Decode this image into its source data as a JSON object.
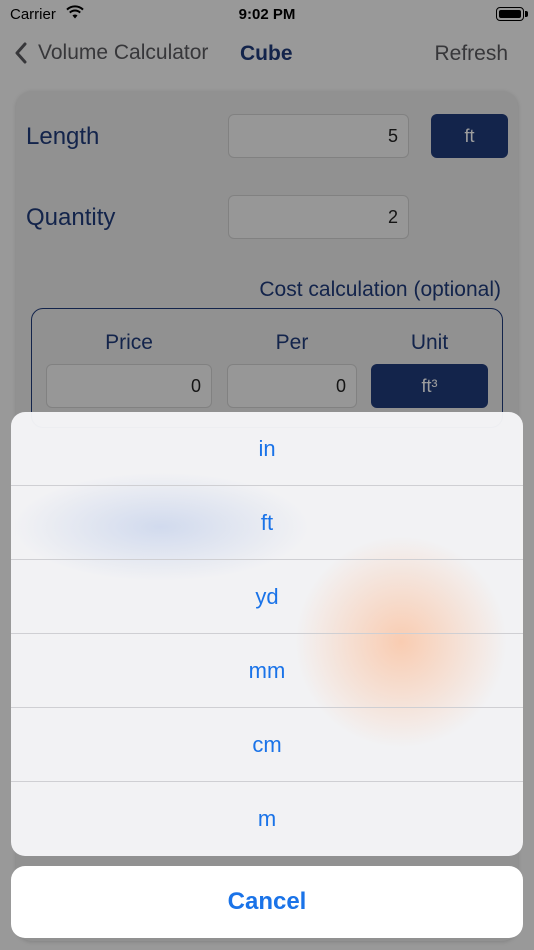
{
  "status_bar": {
    "carrier": "Carrier",
    "time": "9:02 PM"
  },
  "nav": {
    "back_label": "Volume Calculator",
    "title": "Cube",
    "refresh_label": "Refresh"
  },
  "form": {
    "length": {
      "label": "Length",
      "value": "5",
      "unit": "ft"
    },
    "quantity": {
      "label": "Quantity",
      "value": "2"
    },
    "cost": {
      "title": "Cost calculation (optional)",
      "price_label": "Price",
      "price_value": "0",
      "per_label": "Per",
      "per_value": "0",
      "unit_label": "Unit",
      "unit_value": "ft³"
    }
  },
  "action_sheet": {
    "options": [
      "in",
      "ft",
      "yd",
      "mm",
      "cm",
      "m"
    ],
    "cancel_label": "Cancel"
  },
  "colors": {
    "brand": "#1f3a7a",
    "action_blue": "#1a73e8"
  }
}
